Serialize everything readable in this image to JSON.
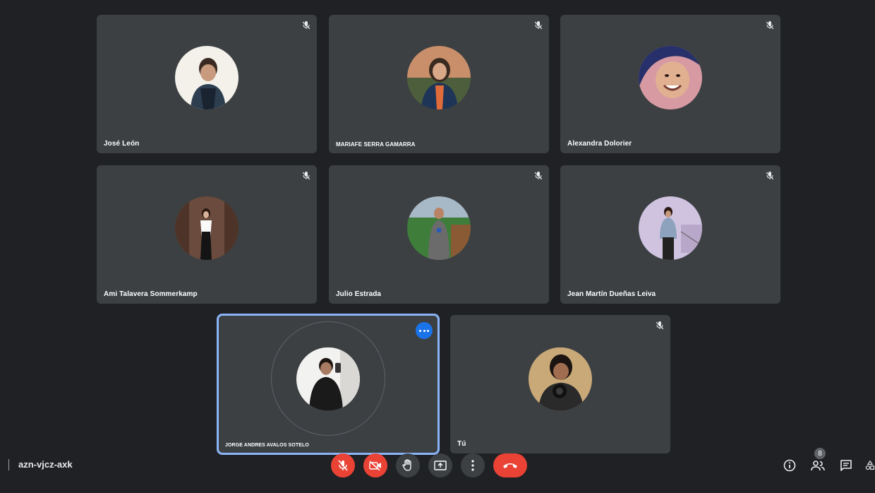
{
  "participants": [
    {
      "name": "José León",
      "muted": true
    },
    {
      "name": "MARIAFE SERRA GAMARRA",
      "muted": true
    },
    {
      "name": "Alexandra Dolorier",
      "muted": true
    },
    {
      "name": "Ami Talavera Sommerkamp",
      "muted": true
    },
    {
      "name": "Julio Estrada",
      "muted": true
    },
    {
      "name": "Jean Martín Dueñas Leiva",
      "muted": true
    },
    {
      "name": "JORGE ANDRES AVALOS SOTELO",
      "muted": false,
      "speaking": true
    },
    {
      "name": "Tú",
      "muted": true
    }
  ],
  "meeting": {
    "code": "azn-vjcz-axk"
  },
  "toolbar": {
    "mic": "mic-off-icon",
    "camera": "camera-off-icon",
    "hand": "raise-hand-icon",
    "present": "present-screen-icon",
    "more": "more-options-icon",
    "hangup": "hang-up-icon"
  },
  "side": {
    "people_count": "8",
    "info": "info-icon",
    "people": "people-icon",
    "chat": "chat-icon",
    "activities": "activities-icon"
  },
  "colors": {
    "background": "#202124",
    "tile": "#3c4043",
    "accent": "#8ab4f8",
    "danger": "#ea4335",
    "more_button": "#1a73e8"
  }
}
